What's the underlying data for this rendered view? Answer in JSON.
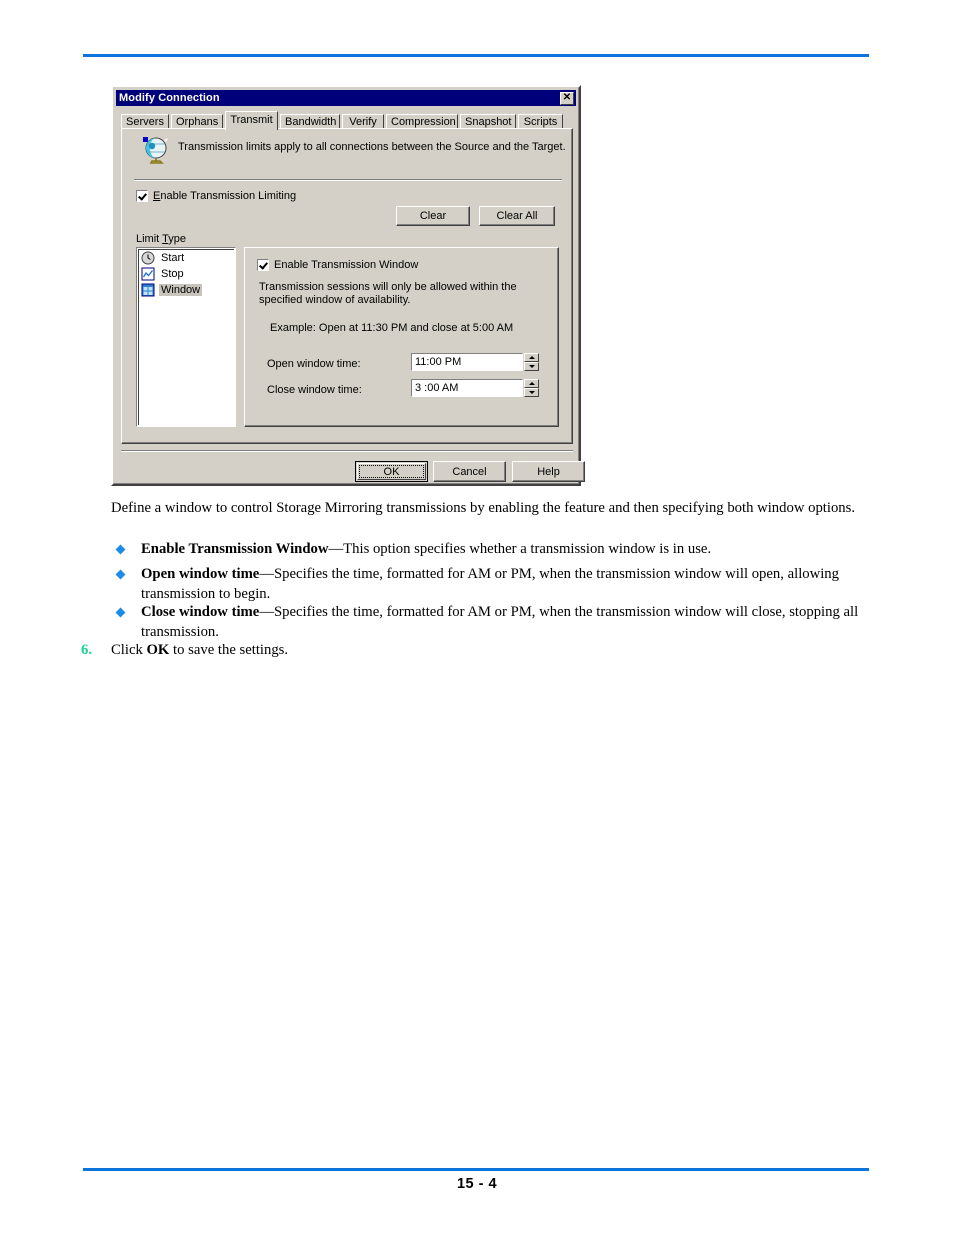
{
  "page": {
    "number": "15 - 4",
    "rule_color": "#0b74dd"
  },
  "dialog": {
    "title": "Modify Connection",
    "close_icon": "✕",
    "tabs": [
      {
        "label": "Servers",
        "active": false
      },
      {
        "label": "Orphans",
        "active": false
      },
      {
        "label": "Transmit",
        "active": true
      },
      {
        "label": "Bandwidth",
        "active": false
      },
      {
        "label": "Verify",
        "active": false
      },
      {
        "label": "Compression",
        "active": false
      },
      {
        "label": "Snapshot",
        "active": false
      },
      {
        "label": "Scripts",
        "active": false
      }
    ],
    "info_text": "Transmission limits apply to all connections between the Source and the Target.",
    "enable_limiting": {
      "label_prefix": "",
      "label_underlined": "E",
      "label_rest": "nable Transmission Limiting",
      "checked": true
    },
    "buttons": {
      "clear": "Clear",
      "clear_all": "Clear All",
      "ok": "OK",
      "cancel": "Cancel",
      "help": "Help"
    },
    "limit_type": {
      "label_prefix": "Limit ",
      "label_underlined": "T",
      "label_rest": "ype",
      "items": [
        {
          "label": "Start",
          "icon": "clock-icon",
          "selected": false
        },
        {
          "label": "Stop",
          "icon": "chart-icon",
          "selected": false
        },
        {
          "label": "Window",
          "icon": "window-icon",
          "selected": true
        }
      ]
    },
    "window_panel": {
      "enable_window_label": "Enable Transmission Window",
      "enable_window_checked": true,
      "description": "Transmission sessions will only be allowed within the specified window of availability.",
      "example": "Example:  Open at 11:30 PM and close at 5:00 AM",
      "open_label": "Open window time:",
      "open_value": "11:00 PM",
      "close_label": "Close window time:",
      "close_value": "3 :00 AM"
    }
  },
  "content": {
    "intro": "Define a window to control Storage Mirroring transmissions by enabling the feature and then specifying both window options.",
    "bullets": [
      {
        "term": "Enable Transmission Window",
        "text": "—This option specifies whether a transmission window is in use."
      },
      {
        "term": "Open window time",
        "text": "—Specifies the time, formatted for AM or PM, when the transmission window will open, allowing transmission to begin."
      },
      {
        "term": "Close window time",
        "text": "—Specifies the time, formatted for AM or PM, when the transmission window will close, stopping all transmission."
      }
    ],
    "step": {
      "number": "6.",
      "prefix": "Click ",
      "bold": "OK",
      "suffix": " to save the settings."
    }
  }
}
